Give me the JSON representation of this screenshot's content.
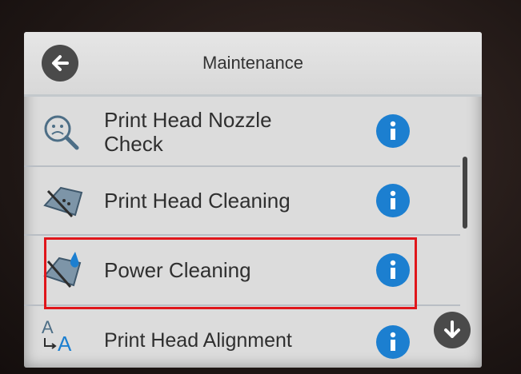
{
  "header": {
    "title": "Maintenance"
  },
  "rows": [
    {
      "label_line1": "Print Head Nozzle",
      "label_line2": "Check",
      "icon": "nozzle-check-icon"
    },
    {
      "label": "Print Head Cleaning",
      "icon": "head-cleaning-icon"
    },
    {
      "label": "Power Cleaning",
      "icon": "power-cleaning-icon"
    },
    {
      "label": "Print Head Alignment",
      "icon": "head-alignment-icon"
    }
  ],
  "colors": {
    "info_blue": "#1c7fd0",
    "highlight_red": "#e0161b",
    "screen_bg": "#dcdcdc"
  },
  "highlight": {
    "target": "Power Cleaning"
  }
}
